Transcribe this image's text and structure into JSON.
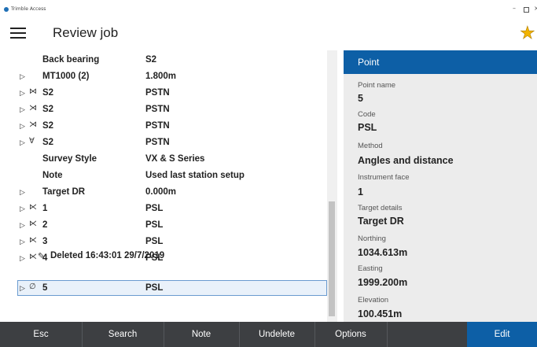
{
  "app": {
    "title": "Trimble Access"
  },
  "header": {
    "title": "Review job"
  },
  "rows": [
    {
      "label": "Back bearing",
      "value": "S2",
      "expander": "",
      "icon": ""
    },
    {
      "label": "MT1000 (2)",
      "value": "1.800m",
      "expander": "▷",
      "icon": ""
    },
    {
      "label": "S2",
      "value": "PSTN",
      "expander": "▷",
      "icon": "⋈"
    },
    {
      "label": "S2",
      "value": "PSTN",
      "expander": "▷",
      "icon": "⋊"
    },
    {
      "label": "S2",
      "value": "PSTN",
      "expander": "▷",
      "icon": "⋊"
    },
    {
      "label": "S2",
      "value": "PSTN",
      "expander": "▷",
      "icon": "∀"
    },
    {
      "label": "Survey Style",
      "value": "VX & S Series",
      "expander": "",
      "icon": ""
    },
    {
      "label": "Note",
      "value": "Used last station setup",
      "expander": "",
      "icon": ""
    },
    {
      "label": "Target DR",
      "value": "0.000m",
      "expander": "▷",
      "icon": ""
    },
    {
      "label": "1",
      "value": "PSL",
      "expander": "▷",
      "icon": "⋉"
    },
    {
      "label": "2",
      "value": "PSL",
      "expander": "▷",
      "icon": "⋉"
    },
    {
      "label": "3",
      "value": "PSL",
      "expander": "▷",
      "icon": "⋉"
    },
    {
      "label": "4",
      "value": "PSL",
      "expander": "▷",
      "icon": "⋉"
    },
    {
      "label": "5",
      "value": "PSL",
      "expander": "▷",
      "icon": "∅"
    }
  ],
  "deleted_note": "Deleted 16:43:01 29/7/2019",
  "panel": {
    "title": "Point",
    "fields": [
      {
        "label": "Point name",
        "value": "5"
      },
      {
        "label": "Code",
        "value": "PSL"
      },
      {
        "label": "Method",
        "value": "Angles and distance"
      },
      {
        "label": "Instrument face",
        "value": "1"
      },
      {
        "label": "Target details",
        "value": "Target DR"
      },
      {
        "label": "Northing",
        "value": "1034.613m"
      },
      {
        "label": "Easting",
        "value": "1999.200m"
      },
      {
        "label": "Elevation",
        "value": "100.451m"
      }
    ]
  },
  "toolbar": {
    "esc": "Esc",
    "search": "Search",
    "note": "Note",
    "undelete": "Undelete",
    "options": "Options",
    "edit": "Edit"
  },
  "colors": {
    "accent": "#0d5fa6",
    "toolbar": "#3d3f42",
    "star": "#f2b400"
  }
}
